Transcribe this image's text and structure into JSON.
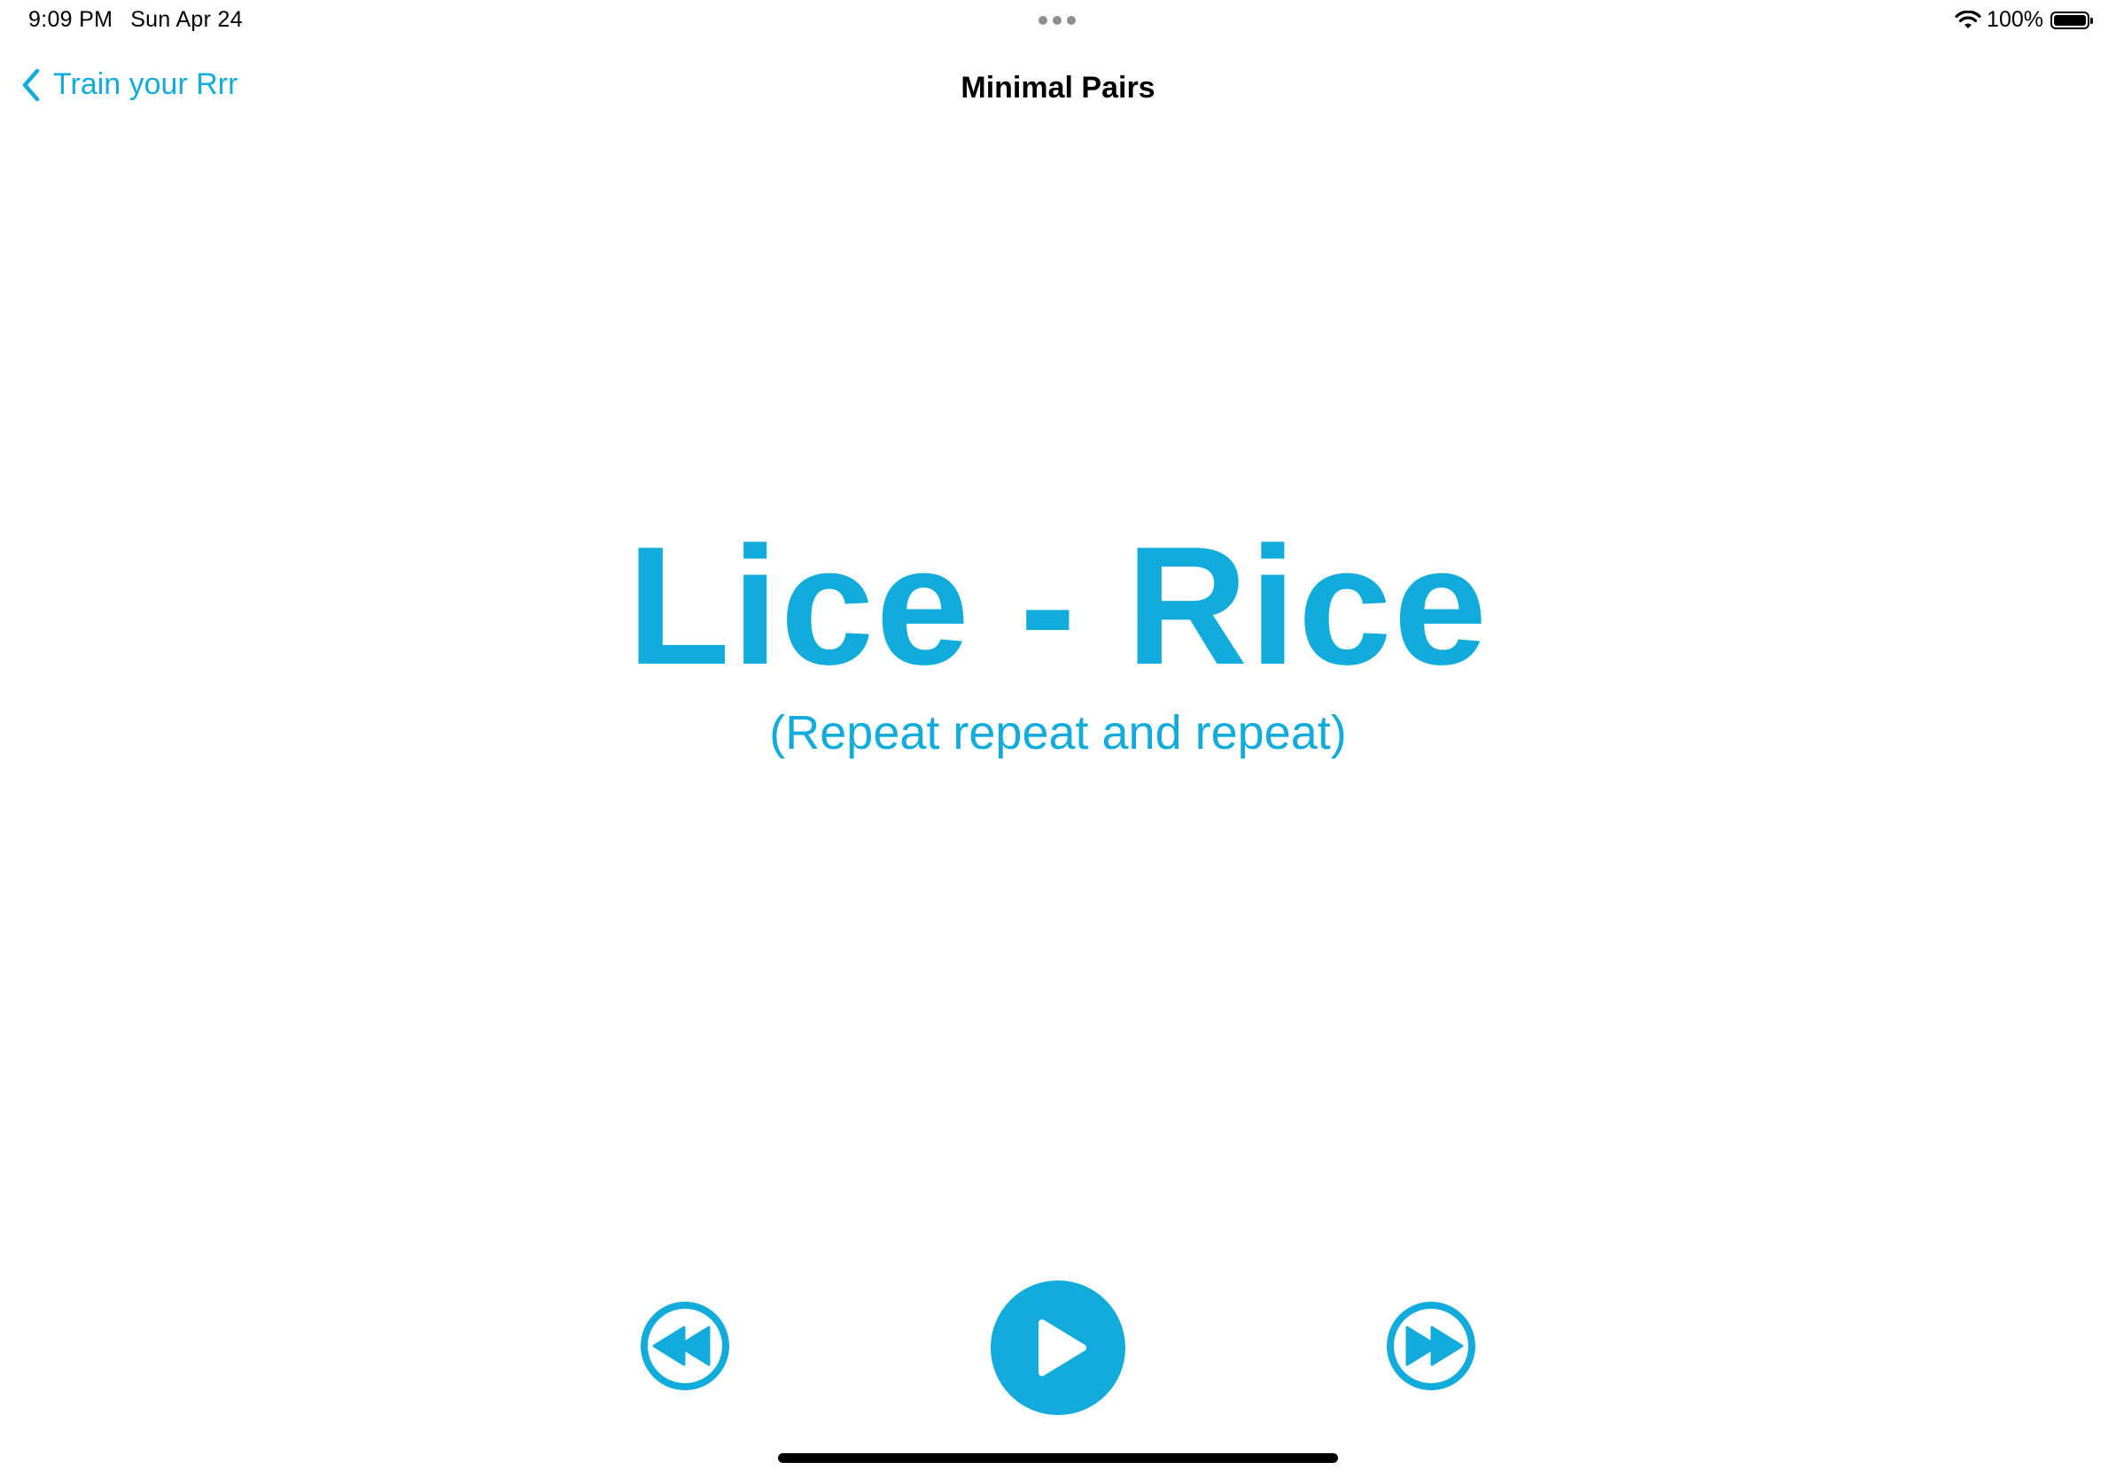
{
  "status_bar": {
    "time": "9:09 PM",
    "date": "Sun Apr 24",
    "battery_text": "100%",
    "battery_level": 1.0,
    "icons": [
      "multitasking-dots-icon",
      "wifi-icon",
      "battery-icon"
    ]
  },
  "nav": {
    "back_label": "Train your Rrr",
    "back_icon": "chevron-left-icon",
    "title": "Minimal Pairs"
  },
  "content": {
    "pair": "Lice - Rice",
    "instruction": "(Repeat repeat and repeat)"
  },
  "controls": {
    "previous_icon": "rewind-icon",
    "play_icon": "play-icon",
    "next_icon": "fast-forward-icon"
  },
  "colors": {
    "accent": "#12acdc",
    "text": "#000000",
    "background": "#ffffff"
  }
}
